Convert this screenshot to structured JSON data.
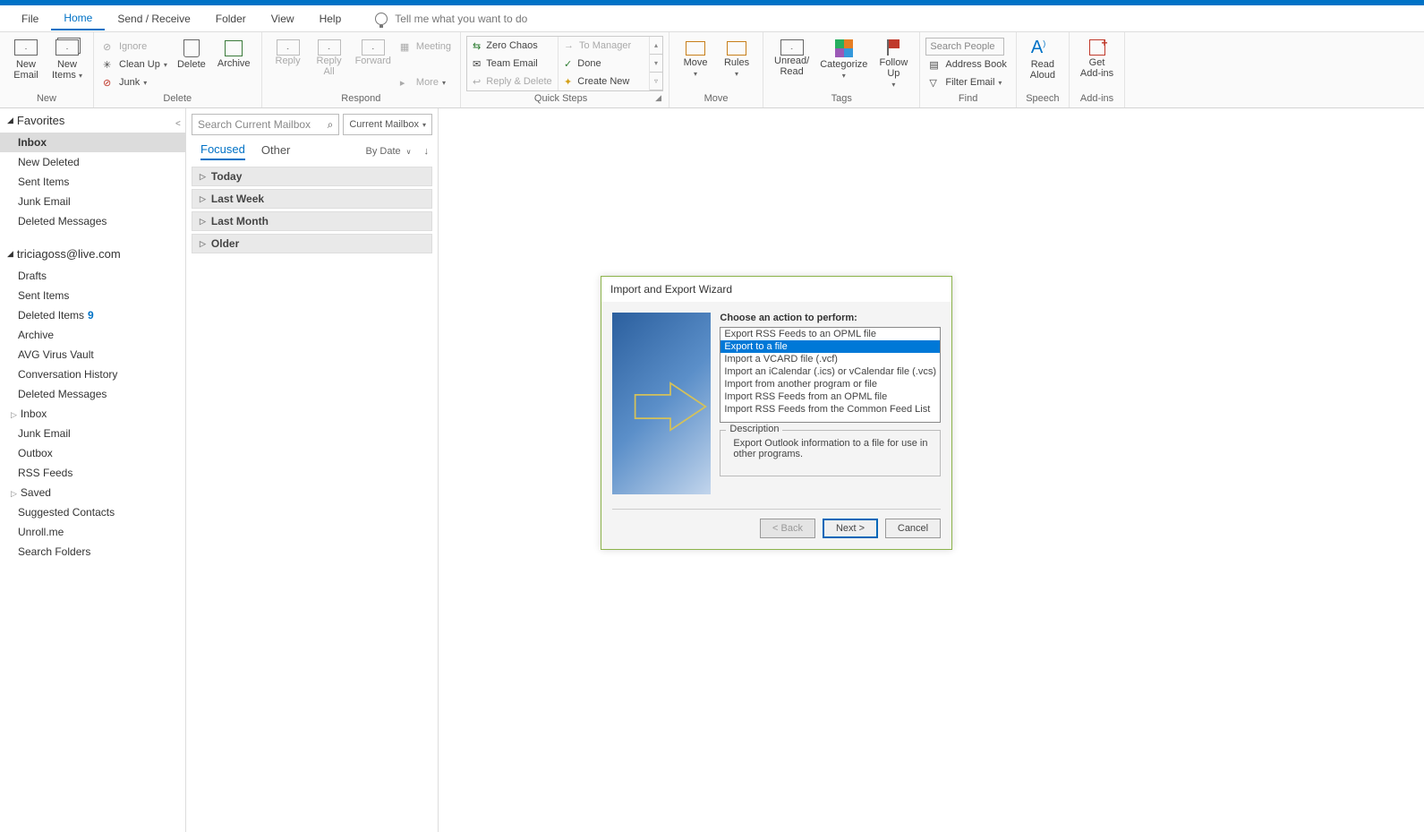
{
  "ribbon_tabs": {
    "file": "File",
    "home": "Home",
    "send": "Send / Receive",
    "folder": "Folder",
    "view": "View",
    "help": "Help",
    "tellme": "Tell me what you want to do"
  },
  "ribbon": {
    "new": {
      "email": "New\nEmail",
      "items": "New\nItems",
      "group": "New"
    },
    "del": {
      "ignore": "Ignore",
      "cleanup": "Clean Up",
      "junk": "Junk",
      "delete": "Delete",
      "archive": "Archive",
      "group": "Delete"
    },
    "resp": {
      "reply": "Reply",
      "replyall": "Reply\nAll",
      "forward": "Forward",
      "meeting": "Meeting",
      "more": "More",
      "group": "Respond"
    },
    "qs": {
      "zero": "Zero Chaos",
      "mgr": "To Manager",
      "team": "Team Email",
      "done": "Done",
      "rd": "Reply & Delete",
      "create": "Create New",
      "group": "Quick Steps"
    },
    "move": {
      "move": "Move",
      "rules": "Rules",
      "group": "Move"
    },
    "tags": {
      "unread": "Unread/\nRead",
      "cat": "Categorize",
      "follow": "Follow\nUp",
      "group": "Tags"
    },
    "find": {
      "search": "Search People",
      "ab": "Address Book",
      "filter": "Filter Email",
      "group": "Find"
    },
    "speech": {
      "read": "Read\nAloud",
      "group": "Speech"
    },
    "addins": {
      "get": "Get\nAdd-ins",
      "group": "Add-ins"
    }
  },
  "nav": {
    "fav": "Favorites",
    "fav_items": [
      "Inbox",
      "New Deleted",
      "Sent Items",
      "Junk Email",
      "Deleted Messages"
    ],
    "acct": "triciagoss@live.com",
    "acct_items": [
      {
        "l": "Drafts"
      },
      {
        "l": "Sent Items"
      },
      {
        "l": "Deleted Items",
        "c": "9"
      },
      {
        "l": "Archive"
      },
      {
        "l": "AVG Virus Vault"
      },
      {
        "l": "Conversation History"
      },
      {
        "l": "Deleted Messages"
      },
      {
        "l": "Inbox",
        "exp": true
      },
      {
        "l": "Junk Email"
      },
      {
        "l": "Outbox"
      },
      {
        "l": "RSS Feeds"
      },
      {
        "l": "Saved",
        "exp": true
      },
      {
        "l": "Suggested Contacts"
      },
      {
        "l": "Unroll.me"
      },
      {
        "l": "Search Folders"
      }
    ]
  },
  "list": {
    "search_ph": "Search Current Mailbox",
    "scope": "Current Mailbox",
    "focused": "Focused",
    "other": "Other",
    "sort": "By Date",
    "groups": [
      "Today",
      "Last Week",
      "Last Month",
      "Older"
    ]
  },
  "dlg": {
    "title": "Import and Export Wizard",
    "choose": "Choose an action to perform:",
    "opts": [
      "Export RSS Feeds to an OPML file",
      "Export to a file",
      "Import a VCARD file (.vcf)",
      "Import an iCalendar (.ics) or vCalendar file (.vcs)",
      "Import from another program or file",
      "Import RSS Feeds from an OPML file",
      "Import RSS Feeds from the Common Feed List"
    ],
    "sel": 1,
    "desc_lbl": "Description",
    "desc": "Export Outlook information to a file for use in other programs.",
    "back": "< Back",
    "next": "Next >",
    "cancel": "Cancel"
  }
}
